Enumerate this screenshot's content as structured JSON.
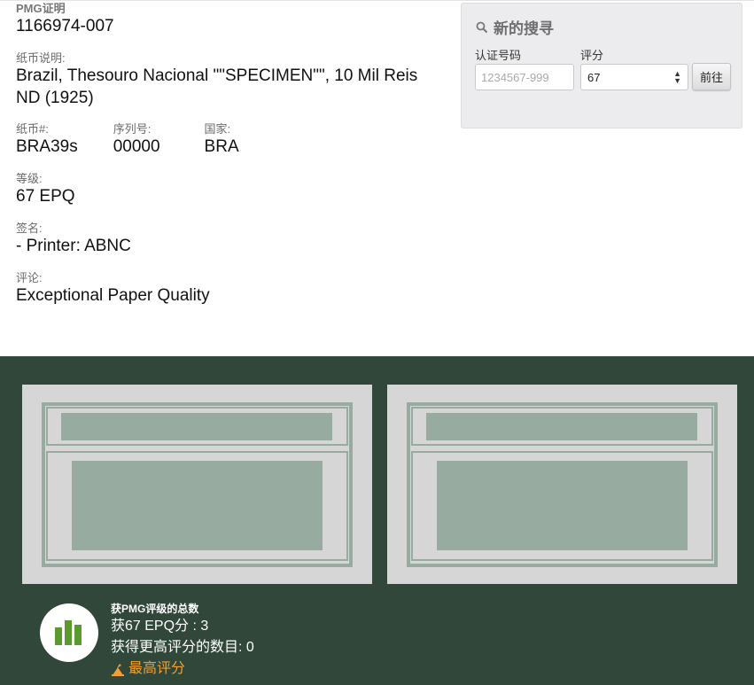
{
  "details": {
    "cert_label": "PMG证明",
    "cert_value": "1166974-007",
    "desc_label": "纸币说明:",
    "desc_line1": "Brazil, Thesouro Nacional \"\"SPECIMEN\"\", 10 Mil Reis",
    "desc_line2": "ND (1925)",
    "note_num_label": "纸币#:",
    "note_num_value": "BRA39s",
    "serial_label": "序列号:",
    "serial_value": "00000",
    "country_label": "国家:",
    "country_value": "BRA",
    "grade_label": "等级:",
    "grade_value": "67 EPQ",
    "signature_label": "签名:",
    "signature_value": "- Printer: ABNC",
    "comment_label": "评论:",
    "comment_value": "Exceptional Paper Quality"
  },
  "search": {
    "title": "新的搜寻",
    "cert_label": "认证号码",
    "cert_placeholder": "1234567-999",
    "grade_label": "评分",
    "grade_selected": "67",
    "go_label": "前往"
  },
  "population": {
    "heading": "获PMG评级的总数",
    "at_grade": "获67 EPQ分 : 3",
    "higher": "获得更高评分的数目: 0",
    "top_grade_link": "最高评分"
  },
  "colors": {
    "band": "#30473a",
    "accent": "#f0a030",
    "chart_icon": "#5a9a2e"
  }
}
